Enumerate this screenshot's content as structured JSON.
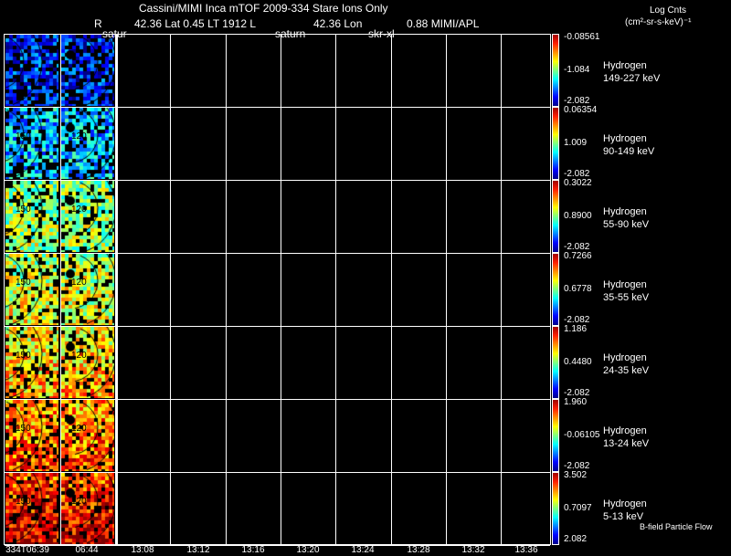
{
  "header": {
    "title": "Cassini/MIMI Inca mTOF  2009-334   Stare   Ions Only",
    "info_r": "R",
    "info": "42.36 Lat 0.45 LT 1912 L",
    "lon": "42.36 Lon",
    "val": "0.88  MIMI/APL",
    "units_line1": "Log Cnts",
    "units_line2": "(cm²-sr-s-keV)⁻¹",
    "marker1": "satur",
    "marker2": "saturn",
    "marker3": "skr-xl"
  },
  "panels": [
    {
      "species": "Hydrogen",
      "energy": "149-227 keV",
      "max": "-0.08561",
      "mid": "-1.084",
      "min": "-2.082",
      "level": 0.15
    },
    {
      "species": "Hydrogen",
      "energy": "90-149 keV",
      "max": "0.06354",
      "mid": "1.009",
      "min": "-2.082",
      "level": 0.3
    },
    {
      "species": "Hydrogen",
      "energy": "55-90 keV",
      "max": "0.3022",
      "mid": "0.8900",
      "min": "-2.082",
      "level": 0.5
    },
    {
      "species": "Hydrogen",
      "energy": "35-55 keV",
      "max": "0.7266",
      "mid": "0.6778",
      "min": "-2.082",
      "level": 0.55
    },
    {
      "species": "Hydrogen",
      "energy": "24-35 keV",
      "max": "1.186",
      "mid": "0.4480",
      "min": "-2.082",
      "level": 0.62
    },
    {
      "species": "Hydrogen",
      "energy": "13-24 keV",
      "max": "1.960",
      "mid": "-0.06105",
      "min": "-2.082",
      "level": 0.7
    },
    {
      "species": "Hydrogen",
      "energy": "5-13 keV",
      "max": "3.502",
      "mid": "0.7097",
      "min": "2.082",
      "level": 0.8
    }
  ],
  "footer_note": "B-field Particle Flow",
  "x_ticks": [
    "334T06:39",
    "06:44",
    "13:08",
    "13:12",
    "13:16",
    "13:20",
    "13:24",
    "13:28",
    "13:32",
    "13:36"
  ],
  "contour_labels": [
    "150",
    "120"
  ]
}
